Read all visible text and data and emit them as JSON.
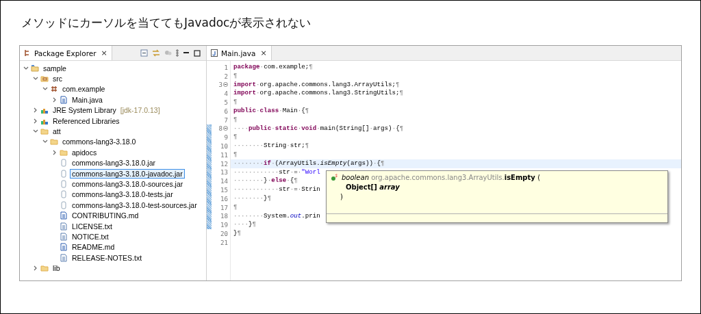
{
  "heading": "メソッドにカーソルを当ててもJavadocが表示されない",
  "explorer": {
    "tab": {
      "label": "Package Explorer",
      "close": "×",
      "selected": true
    },
    "tree": [
      {
        "label": "sample",
        "kind": "project",
        "expanded": true,
        "selected": false,
        "children": [
          {
            "label": "src",
            "kind": "source-folder",
            "expanded": true,
            "selected": false,
            "children": [
              {
                "label": "com.example",
                "kind": "package",
                "expanded": true,
                "selected": false,
                "children": [
                  {
                    "label": "Main.java",
                    "kind": "java-file",
                    "expanded": false,
                    "selected": false
                  }
                ]
              }
            ]
          },
          {
            "label": "JRE System Library",
            "decoration": "[jdk-17.0.13]",
            "kind": "library",
            "expanded": false,
            "selected": false
          },
          {
            "label": "Referenced Libraries",
            "kind": "library",
            "expanded": false,
            "selected": false
          },
          {
            "label": "att",
            "kind": "folder",
            "expanded": true,
            "selected": false,
            "children": [
              {
                "label": "commons-lang3-3.18.0",
                "kind": "folder",
                "expanded": true,
                "selected": false,
                "children": [
                  {
                    "label": "apidocs",
                    "kind": "folder",
                    "expanded": false,
                    "selected": false
                  },
                  {
                    "label": "commons-lang3-3.18.0.jar",
                    "kind": "jar",
                    "selected": false
                  },
                  {
                    "label": "commons-lang3-3.18.0-javadoc.jar",
                    "kind": "jar",
                    "selected": true
                  },
                  {
                    "label": "commons-lang3-3.18.0-sources.jar",
                    "kind": "jar",
                    "selected": false
                  },
                  {
                    "label": "commons-lang3-3.18.0-tests.jar",
                    "kind": "jar",
                    "selected": false
                  },
                  {
                    "label": "commons-lang3-3.18.0-test-sources.jar",
                    "kind": "jar",
                    "selected": false
                  },
                  {
                    "label": "CONTRIBUTING.md",
                    "kind": "word-file",
                    "selected": false
                  },
                  {
                    "label": "LICENSE.txt",
                    "kind": "text-file",
                    "selected": false
                  },
                  {
                    "label": "NOTICE.txt",
                    "kind": "text-file",
                    "selected": false
                  },
                  {
                    "label": "README.md",
                    "kind": "word-file",
                    "selected": false
                  },
                  {
                    "label": "RELEASE-NOTES.txt",
                    "kind": "text-file",
                    "selected": false
                  }
                ]
              }
            ]
          },
          {
            "label": "lib",
            "kind": "folder",
            "expanded": false,
            "selected": false
          }
        ]
      }
    ]
  },
  "editor": {
    "tab": {
      "label": "Main.java",
      "close": "×",
      "selected": true
    },
    "lines": [
      {
        "number": "1",
        "tokens": [
          {
            "kind": "kw",
            "text": "package"
          },
          {
            "kind": "ws",
            "text": "·"
          },
          {
            "kind": "plain",
            "text": "com.example;"
          },
          {
            "kind": "ws",
            "text": "¶"
          }
        ]
      },
      {
        "number": "2",
        "tokens": [
          {
            "kind": "ws",
            "text": "¶"
          }
        ]
      },
      {
        "number": "3",
        "fold": true,
        "tokens": [
          {
            "kind": "kw",
            "text": "import"
          },
          {
            "kind": "ws",
            "text": "·"
          },
          {
            "kind": "plain",
            "text": "org.apache.commons.lang3.ArrayUtils;"
          },
          {
            "kind": "ws",
            "text": "¶"
          }
        ]
      },
      {
        "number": "4",
        "tokens": [
          {
            "kind": "kw",
            "text": "import"
          },
          {
            "kind": "ws",
            "text": "·"
          },
          {
            "kind": "plain",
            "text": "org.apache.commons.lang3.StringUtils;"
          },
          {
            "kind": "ws",
            "text": "¶"
          }
        ]
      },
      {
        "number": "5",
        "tokens": [
          {
            "kind": "ws",
            "text": "¶"
          }
        ]
      },
      {
        "number": "6",
        "tokens": [
          {
            "kind": "kw",
            "text": "public"
          },
          {
            "kind": "ws",
            "text": "·"
          },
          {
            "kind": "kw",
            "text": "class"
          },
          {
            "kind": "ws",
            "text": "·"
          },
          {
            "kind": "plain",
            "text": "Main"
          },
          {
            "kind": "ws",
            "text": "·"
          },
          {
            "kind": "plain",
            "text": "{"
          },
          {
            "kind": "ws",
            "text": "¶"
          }
        ]
      },
      {
        "number": "7",
        "tokens": [
          {
            "kind": "ws",
            "text": "¶"
          }
        ]
      },
      {
        "number": "8",
        "fold": true,
        "changed": true,
        "tokens": [
          {
            "kind": "ws",
            "text": "····"
          },
          {
            "kind": "kw",
            "text": "public"
          },
          {
            "kind": "ws",
            "text": "·"
          },
          {
            "kind": "kw",
            "text": "static"
          },
          {
            "kind": "ws",
            "text": "·"
          },
          {
            "kind": "kw",
            "text": "void"
          },
          {
            "kind": "ws",
            "text": "·"
          },
          {
            "kind": "plain",
            "text": "main(String[]"
          },
          {
            "kind": "ws",
            "text": "·"
          },
          {
            "kind": "plain",
            "text": "args)"
          },
          {
            "kind": "ws",
            "text": "·"
          },
          {
            "kind": "plain",
            "text": "{"
          },
          {
            "kind": "ws",
            "text": "¶"
          }
        ]
      },
      {
        "number": "9",
        "changed": true,
        "tokens": [
          {
            "kind": "ws",
            "text": "¶"
          }
        ]
      },
      {
        "number": "10",
        "changed": true,
        "tokens": [
          {
            "kind": "ws",
            "text": "········"
          },
          {
            "kind": "plain",
            "text": "String"
          },
          {
            "kind": "ws",
            "text": "·"
          },
          {
            "kind": "plain",
            "text": "str;"
          },
          {
            "kind": "ws",
            "text": "¶"
          }
        ]
      },
      {
        "number": "11",
        "changed": true,
        "tokens": [
          {
            "kind": "ws",
            "text": "¶"
          }
        ]
      },
      {
        "number": "12",
        "changed": true,
        "current": true,
        "tokens": [
          {
            "kind": "ws",
            "text": "········"
          },
          {
            "kind": "kw",
            "text": "if"
          },
          {
            "kind": "ws",
            "text": "·"
          },
          {
            "kind": "plain",
            "text": "(ArrayUtils."
          },
          {
            "kind": "static",
            "text": "isEmpty"
          },
          {
            "kind": "plain",
            "text": "(args))"
          },
          {
            "kind": "ws",
            "text": "·"
          },
          {
            "kind": "plain",
            "text": "{"
          },
          {
            "kind": "ws",
            "text": "¶"
          }
        ]
      },
      {
        "number": "13",
        "changed": true,
        "tokens": [
          {
            "kind": "ws",
            "text": "············"
          },
          {
            "kind": "plain",
            "text": "str"
          },
          {
            "kind": "ws",
            "text": "·"
          },
          {
            "kind": "plain",
            "text": "="
          },
          {
            "kind": "ws",
            "text": "·"
          },
          {
            "kind": "str",
            "text": "\"Worl"
          }
        ]
      },
      {
        "number": "14",
        "changed": true,
        "tokens": [
          {
            "kind": "ws",
            "text": "········"
          },
          {
            "kind": "plain",
            "text": "}"
          },
          {
            "kind": "ws",
            "text": "·"
          },
          {
            "kind": "kw",
            "text": "else"
          },
          {
            "kind": "ws",
            "text": "·"
          },
          {
            "kind": "plain",
            "text": "{"
          },
          {
            "kind": "ws",
            "text": "¶"
          }
        ]
      },
      {
        "number": "15",
        "changed": true,
        "tokens": [
          {
            "kind": "ws",
            "text": "············"
          },
          {
            "kind": "plain",
            "text": "str"
          },
          {
            "kind": "ws",
            "text": "·"
          },
          {
            "kind": "plain",
            "text": "="
          },
          {
            "kind": "ws",
            "text": "·"
          },
          {
            "kind": "plain",
            "text": "Strin"
          }
        ]
      },
      {
        "number": "16",
        "changed": true,
        "tokens": [
          {
            "kind": "ws",
            "text": "········"
          },
          {
            "kind": "plain",
            "text": "}"
          },
          {
            "kind": "ws",
            "text": "¶"
          }
        ]
      },
      {
        "number": "17",
        "changed": true,
        "tokens": [
          {
            "kind": "ws",
            "text": "¶"
          }
        ]
      },
      {
        "number": "18",
        "changed": true,
        "tokens": [
          {
            "kind": "ws",
            "text": "········"
          },
          {
            "kind": "plain",
            "text": "System."
          },
          {
            "kind": "field",
            "text": "out"
          },
          {
            "kind": "plain",
            "text": ".prin"
          }
        ]
      },
      {
        "number": "19",
        "changed": true,
        "tokens": [
          {
            "kind": "ws",
            "text": "····"
          },
          {
            "kind": "plain",
            "text": "}"
          },
          {
            "kind": "ws",
            "text": "¶"
          }
        ]
      },
      {
        "number": "20",
        "tokens": [
          {
            "kind": "plain",
            "text": "}"
          },
          {
            "kind": "ws",
            "text": "¶"
          }
        ]
      },
      {
        "number": "21"
      }
    ],
    "hover": {
      "signature": [
        {
          "kind": "type",
          "text": "boolean"
        },
        {
          "kind": "qualifier",
          "text": "org.apache.commons.lang3.ArrayUtils."
        },
        {
          "kind": "name",
          "text": "isEmpty"
        },
        {
          "kind": "plain",
          "text": "("
        }
      ],
      "params": "Object[] *array*",
      "close": ")"
    }
  }
}
